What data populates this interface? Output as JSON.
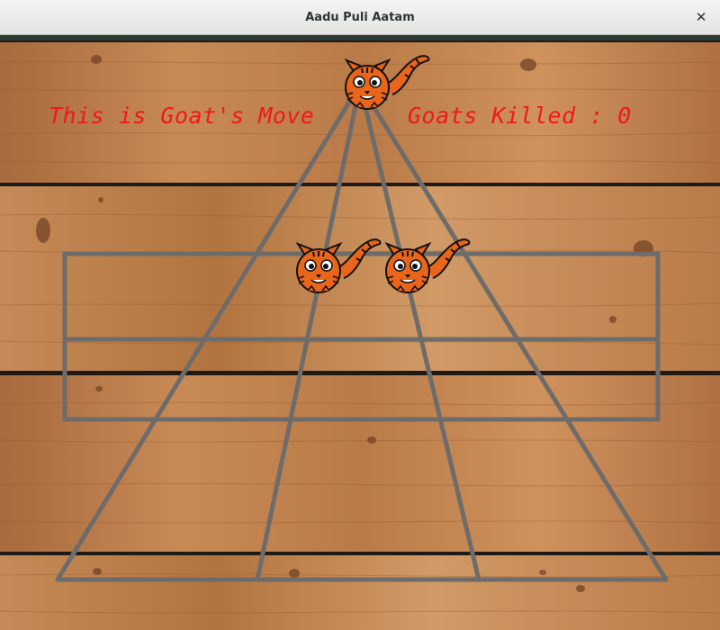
{
  "window": {
    "title": "Aadu Puli Aatam",
    "close_icon": "close-icon"
  },
  "game": {
    "turn_text": "This is Goat's Move",
    "goats_killed_label": "Goats Killed : ",
    "goats_killed": "0",
    "text_color": "#ee1a1a",
    "line_color": "#6e6c6a",
    "pieces": [
      {
        "type": "tiger",
        "position": "apex"
      },
      {
        "type": "tiger",
        "position": "row-1-col-2"
      },
      {
        "type": "tiger",
        "position": "row-1-col-3"
      }
    ]
  }
}
